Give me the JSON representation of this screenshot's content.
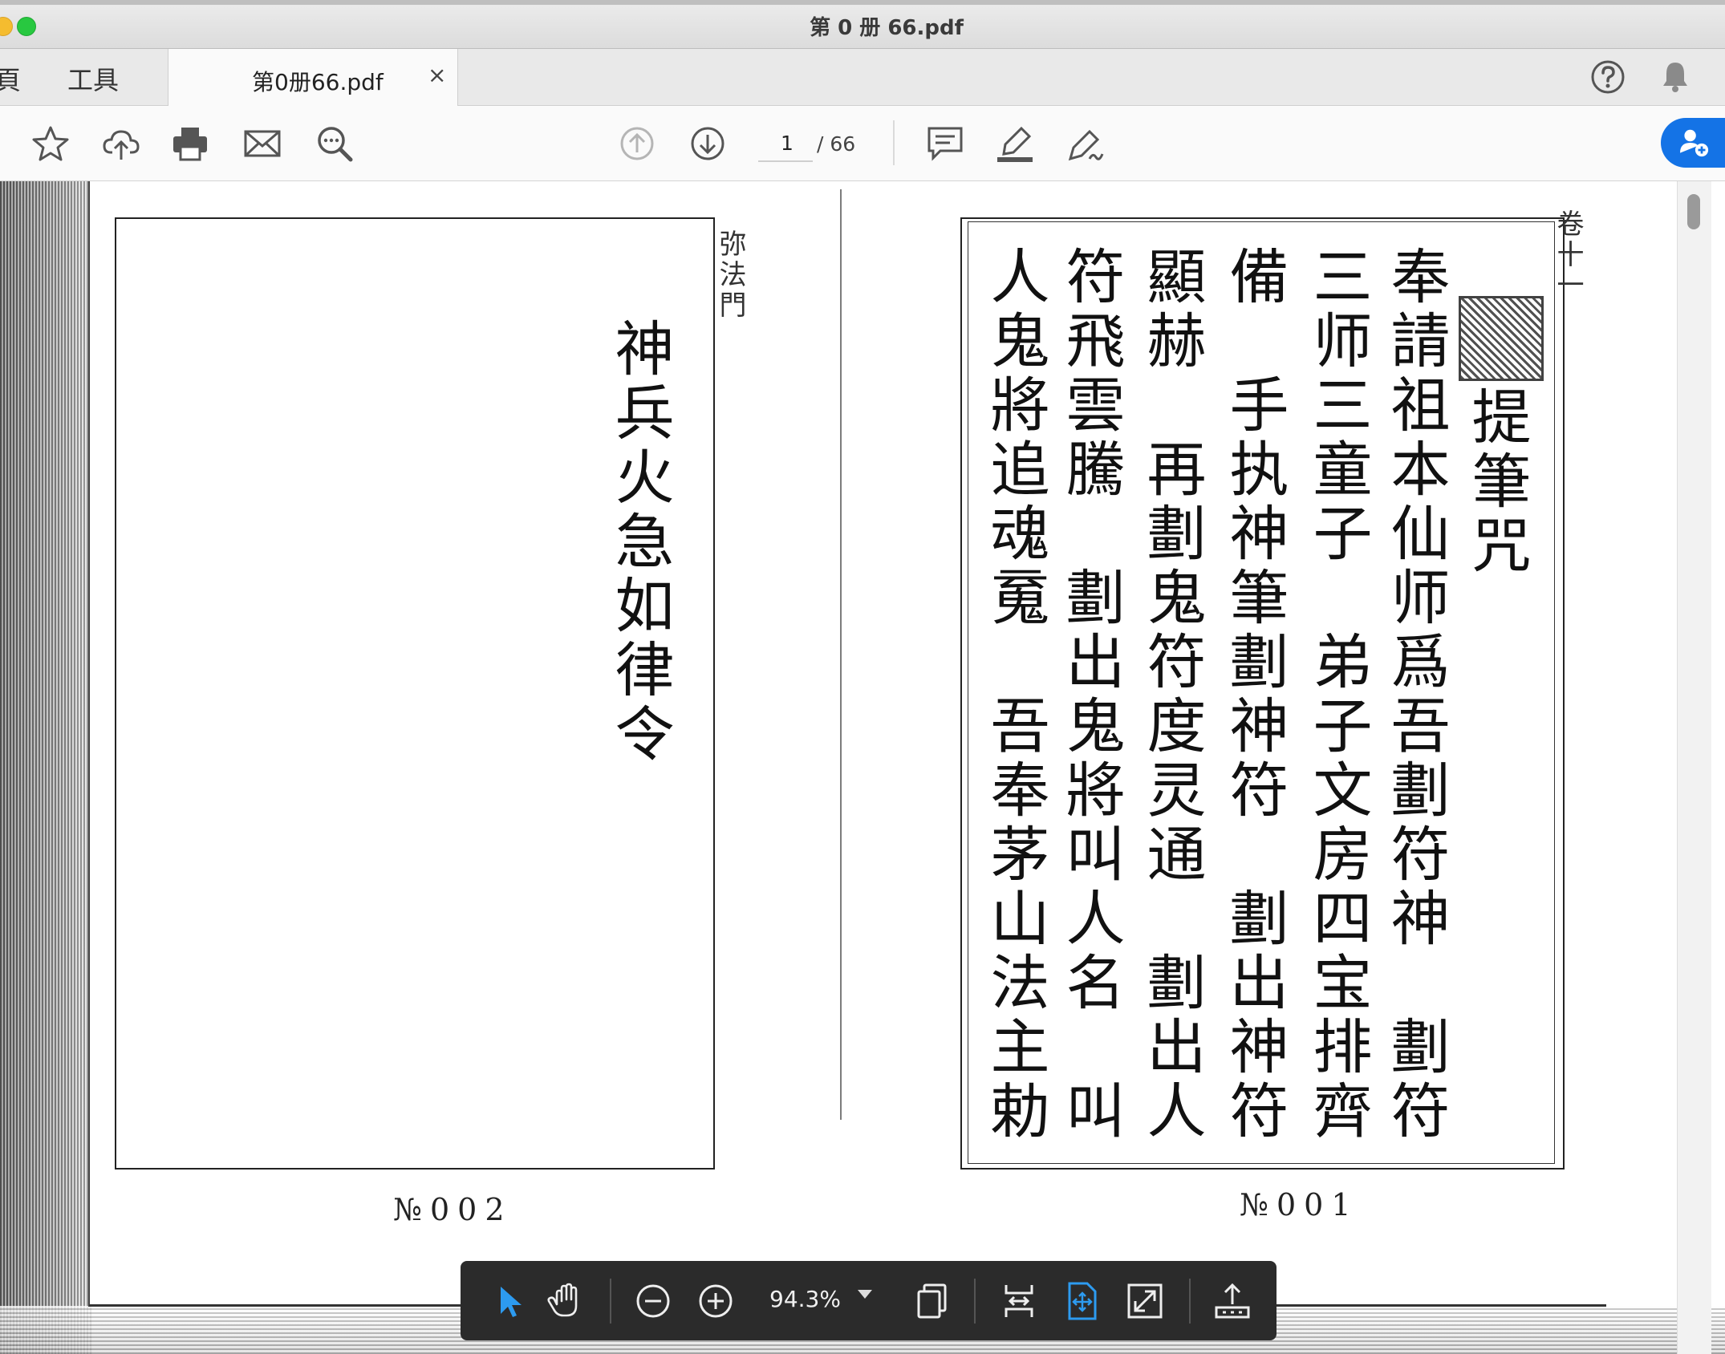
{
  "window": {
    "title": "第 0 册 66.pdf"
  },
  "nav": {
    "home_label": "頁",
    "tools_label": "工具"
  },
  "doc_tab": {
    "label": "第0册66.pdf",
    "close_glyph": "×"
  },
  "toolbar": {
    "icons": [
      "star-icon",
      "upload-cloud-icon",
      "print-icon",
      "email-icon",
      "search-zoom-icon",
      "page-up-icon",
      "page-down-icon",
      "comment-icon",
      "highlight-pen-icon",
      "sign-pen-icon"
    ],
    "current_page": "1",
    "total_pages": "/ 66"
  },
  "header_right": {
    "icons": [
      "help-icon",
      "bell-icon",
      "add-user-icon"
    ]
  },
  "accent_color": "#1473e6",
  "document": {
    "left_page": {
      "columns": [
        "神兵火急如律令"
      ],
      "edge_text": "弥法門",
      "page_number": "№002"
    },
    "right_page": {
      "columns": [
        "提筆咒",
        "奉請祖本仙师爲吾劃符神　劃符",
        "三师三童子　弟子文房四宝排齊",
        "備　手执神筆劃神符　劃出神符",
        "顯赫　再劃鬼符度灵通　劃出人",
        "符飛雲騰　劃出鬼將叫人名　叫",
        "人鬼將追魂䰟　吾奉茅山法主勅"
      ],
      "edge_text": "卷十一",
      "page_number": "№001"
    }
  },
  "bottom_toolbar": {
    "zoom_value": "94.3%",
    "icons": [
      "select-arrow-icon",
      "hand-icon",
      "zoom-out-icon",
      "zoom-in-icon",
      "page-display-icon",
      "fit-width-icon",
      "fit-page-icon",
      "full-screen-icon",
      "export-icon"
    ]
  }
}
